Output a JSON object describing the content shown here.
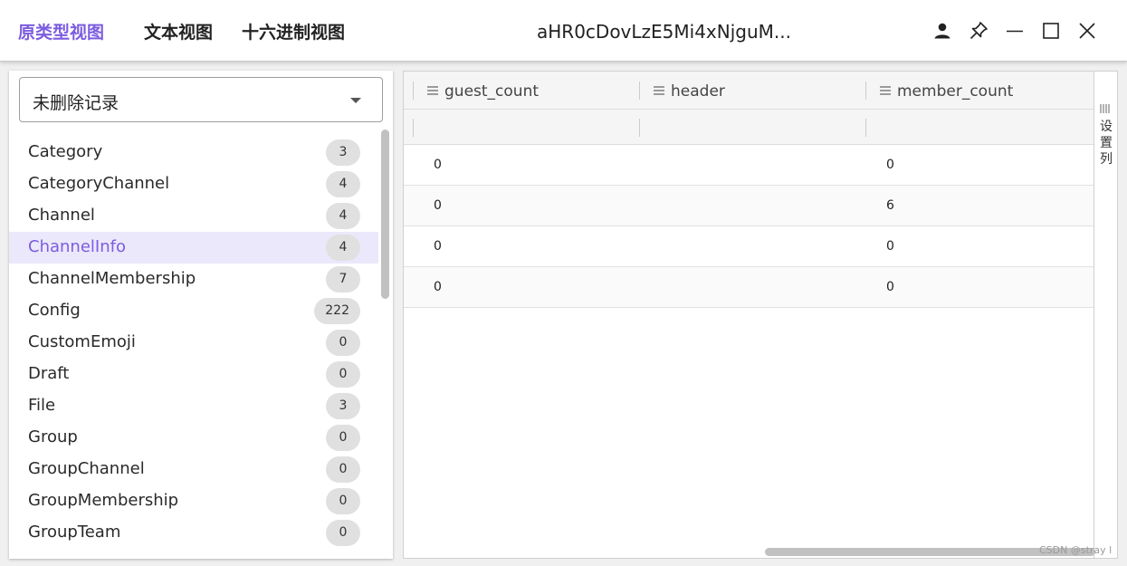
{
  "titlebar": {
    "tabs": [
      {
        "label": "原类型视图",
        "active": true
      },
      {
        "label": "文本视图",
        "active": false
      },
      {
        "label": "十六进制视图",
        "active": false
      }
    ],
    "window_title": "aHR0cDovLzE5Mi4xNjguM...",
    "icons": [
      "user-icon",
      "pin-icon",
      "minimize-icon",
      "maximize-icon",
      "close-icon"
    ]
  },
  "colors": {
    "accent": "#7b5ce0",
    "active_row_bg": "#ebe8fb"
  },
  "filter": {
    "selected": "未删除记录"
  },
  "tables": [
    {
      "name": "Category",
      "count": "3"
    },
    {
      "name": "CategoryChannel",
      "count": "4"
    },
    {
      "name": "Channel",
      "count": "4"
    },
    {
      "name": "ChannelInfo",
      "count": "4",
      "active": true
    },
    {
      "name": "ChannelMembership",
      "count": "7"
    },
    {
      "name": "Config",
      "count": "222"
    },
    {
      "name": "CustomEmoji",
      "count": "0"
    },
    {
      "name": "Draft",
      "count": "0"
    },
    {
      "name": "File",
      "count": "3"
    },
    {
      "name": "Group",
      "count": "0"
    },
    {
      "name": "GroupChannel",
      "count": "0"
    },
    {
      "name": "GroupMembership",
      "count": "0"
    },
    {
      "name": "GroupTeam",
      "count": "0"
    }
  ],
  "grid": {
    "columns": [
      "guest_count",
      "header",
      "member_count"
    ],
    "rows": [
      [
        "0",
        "",
        "0"
      ],
      [
        "0",
        "",
        "6"
      ],
      [
        "0",
        "",
        "0"
      ],
      [
        "0",
        "",
        "0"
      ]
    ]
  },
  "column_settings_label": "设置列",
  "watermark": "CSDN @stray l"
}
